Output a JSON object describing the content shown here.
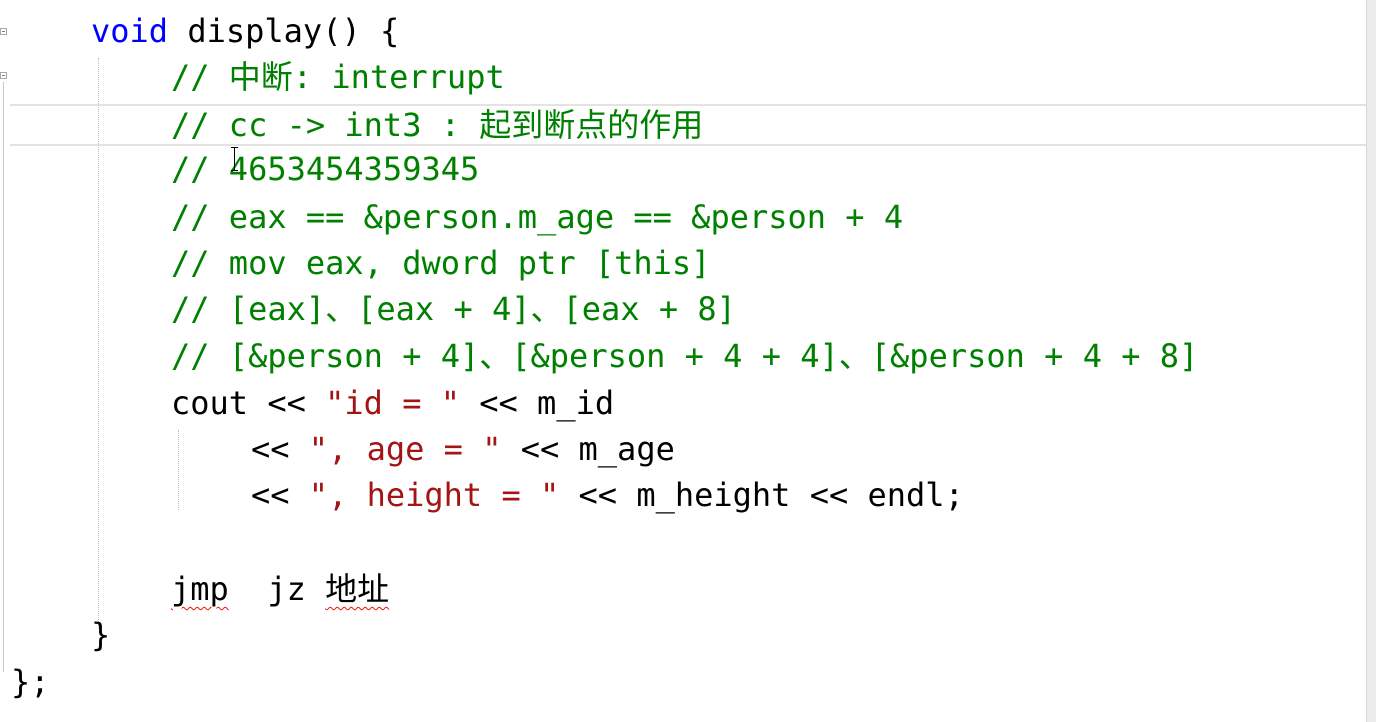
{
  "editor": {
    "lines": {
      "l1": {
        "kw": "void",
        "rest": " display() {"
      },
      "l2": {
        "comment": "// 中断: interrupt"
      },
      "l3": {
        "comment": "// cc -> int3 : 起到断点的作用"
      },
      "l4": {
        "comment": "// 4653454359345"
      },
      "l5": {
        "comment": "// eax == &person.m_age == &person + 4"
      },
      "l6": {
        "comment": "// mov eax, dword ptr [this]"
      },
      "l7": {
        "comment": "// [eax]、[eax + 4]、[eax + 8]"
      },
      "l8": {
        "comment": "// [&person + 4]、[&person + 4 + 4]、[&person + 4 + 8]"
      },
      "l9": {
        "a": "cout << ",
        "s": "\"id = \"",
        "b": " << m_id"
      },
      "l10": {
        "a": "<< ",
        "s": "\", age = \"",
        "b": " << m_age"
      },
      "l11": {
        "a": "<< ",
        "s": "\", height = \"",
        "b": " << m_height << endl;"
      },
      "l13": {
        "w1": "jmp",
        "mid": "  jz ",
        "w2": "地址"
      },
      "l14": {
        "text": "}"
      },
      "l15": {
        "text": "};"
      }
    }
  }
}
